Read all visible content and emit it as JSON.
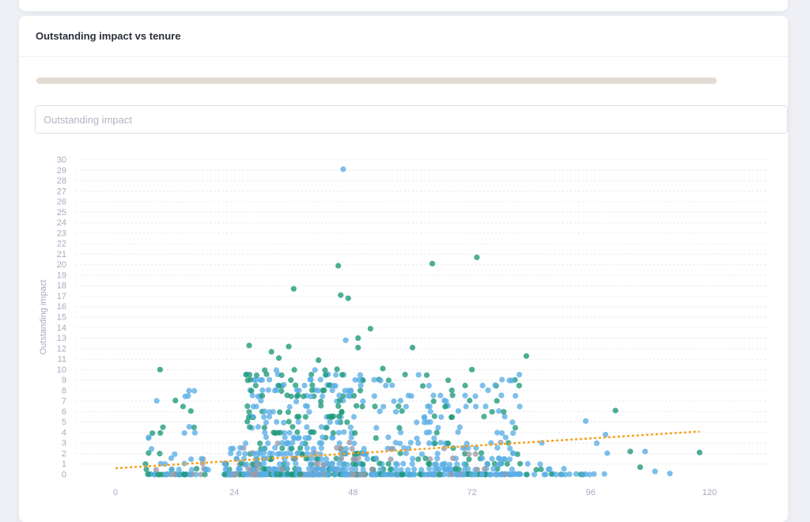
{
  "card": {
    "title": "Outstanding impact vs tenure",
    "progress": 1.0
  },
  "filter": {
    "placeholder": "Outstanding impact",
    "value": ""
  },
  "colors": {
    "blue": "#5aaee6",
    "green": "#1e9a7a",
    "gray": "#9a9aa8",
    "trend": "#f5a11c",
    "tick": "#a7aac2"
  },
  "chart_data": {
    "type": "scatter",
    "ylabel": "Outstanding impact",
    "xlabel": "",
    "xlim": [
      -8,
      132
    ],
    "ylim": [
      0,
      30
    ],
    "x_ticks": [
      0,
      24,
      48,
      72,
      96,
      120
    ],
    "y_ticks": [
      0,
      1,
      2,
      3,
      4,
      5,
      6,
      7,
      8,
      9,
      10,
      11,
      12,
      13,
      14,
      15,
      16,
      17,
      18,
      19,
      20,
      21,
      22,
      23,
      24,
      25,
      26,
      27,
      28,
      29,
      30
    ],
    "grid": true,
    "trendline": {
      "x0": 0,
      "y0": 0.6,
      "x1": 118,
      "y1": 4.1
    },
    "outliers": [
      {
        "x": 46,
        "y": 29.1,
        "group": "blue"
      },
      {
        "x": 45,
        "y": 19.9,
        "group": "green"
      },
      {
        "x": 64,
        "y": 20.1,
        "group": "green"
      },
      {
        "x": 73,
        "y": 20.7,
        "group": "green"
      },
      {
        "x": 36,
        "y": 17.7,
        "group": "green"
      },
      {
        "x": 45.5,
        "y": 17.1,
        "group": "green"
      },
      {
        "x": 47,
        "y": 16.8,
        "group": "green"
      },
      {
        "x": 51.5,
        "y": 13.9,
        "group": "green"
      },
      {
        "x": 49,
        "y": 13.0,
        "group": "green"
      },
      {
        "x": 46.5,
        "y": 12.8,
        "group": "blue"
      },
      {
        "x": 49,
        "y": 12.1,
        "group": "green"
      },
      {
        "x": 27,
        "y": 12.3,
        "group": "green"
      },
      {
        "x": 35,
        "y": 12.2,
        "group": "green"
      },
      {
        "x": 31.5,
        "y": 11.7,
        "group": "green"
      },
      {
        "x": 60,
        "y": 12.1,
        "group": "green"
      },
      {
        "x": 83,
        "y": 11.3,
        "group": "green"
      },
      {
        "x": 9,
        "y": 10.0,
        "group": "green"
      },
      {
        "x": 41,
        "y": 10.9,
        "group": "green"
      },
      {
        "x": 33,
        "y": 11.1,
        "group": "green"
      },
      {
        "x": 54,
        "y": 10.1,
        "group": "green"
      },
      {
        "x": 72,
        "y": 10.0,
        "group": "green"
      },
      {
        "x": 101,
        "y": 6.1,
        "group": "green"
      },
      {
        "x": 118,
        "y": 2.1,
        "group": "green"
      },
      {
        "x": 112,
        "y": 0.1,
        "group": "blue"
      },
      {
        "x": 109,
        "y": 0.3,
        "group": "blue"
      },
      {
        "x": 106,
        "y": 0.7,
        "group": "green"
      },
      {
        "x": 104,
        "y": 2.2,
        "group": "green"
      },
      {
        "x": 107,
        "y": 2.2,
        "group": "blue"
      },
      {
        "x": 99,
        "y": 3.8,
        "group": "blue"
      },
      {
        "x": 95,
        "y": 5.1,
        "group": "blue"
      }
    ],
    "clusters": [
      {
        "x": [
          6,
          19
        ],
        "y": [
          0,
          4
        ],
        "n": 60,
        "groups": {
          "blue": 0.6,
          "green": 0.25,
          "gray": 0.15
        }
      },
      {
        "x": [
          8,
          17
        ],
        "y": [
          4,
          8
        ],
        "n": 14,
        "groups": {
          "blue": 0.6,
          "green": 0.4
        }
      },
      {
        "x": [
          22,
          50
        ],
        "y": [
          0,
          3
        ],
        "n": 420,
        "groups": {
          "blue": 0.6,
          "green": 0.25,
          "gray": 0.15
        }
      },
      {
        "x": [
          26,
          50
        ],
        "y": [
          3,
          10
        ],
        "n": 190,
        "groups": {
          "blue": 0.6,
          "green": 0.4
        }
      },
      {
        "x": [
          50,
          82
        ],
        "y": [
          0,
          3
        ],
        "n": 250,
        "groups": {
          "blue": 0.7,
          "green": 0.2,
          "gray": 0.1
        }
      },
      {
        "x": [
          52,
          82
        ],
        "y": [
          3,
          9.5
        ],
        "n": 100,
        "groups": {
          "blue": 0.7,
          "green": 0.3
        }
      },
      {
        "x": [
          82,
          100
        ],
        "y": [
          0,
          3
        ],
        "n": 30,
        "groups": {
          "blue": 0.7,
          "green": 0.3
        }
      }
    ]
  }
}
